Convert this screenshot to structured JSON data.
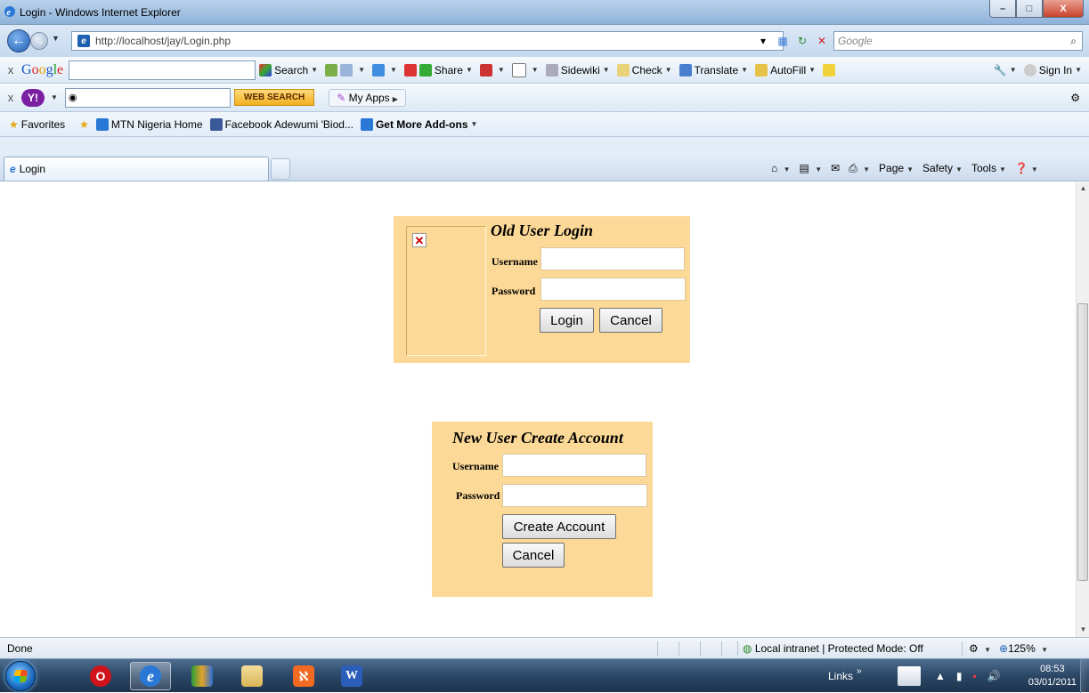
{
  "window": {
    "title": "Login - Windows Internet Explorer",
    "controls": {
      "minimize": "–",
      "maximize": "□",
      "close": "X"
    }
  },
  "address_bar": {
    "url": "http://localhost/jay/Login.php",
    "search_placeholder": "Google"
  },
  "google_toolbar": {
    "close": "x",
    "logo": [
      "G",
      "o",
      "o",
      "g",
      "l",
      "e"
    ],
    "items": [
      {
        "label": "Search",
        "icon": "search-icon"
      },
      {
        "label": "Share",
        "icon": "share-icon"
      },
      {
        "label": "Sidewiki",
        "icon": "sidewiki-icon"
      },
      {
        "label": "Check",
        "icon": "spellcheck-icon"
      },
      {
        "label": "Translate",
        "icon": "translate-icon"
      },
      {
        "label": "AutoFill",
        "icon": "autofill-icon"
      }
    ],
    "sign_in": "Sign In"
  },
  "yahoo_toolbar": {
    "close": "x",
    "logo": "Y!",
    "web_search": "WEB SEARCH",
    "my_apps": "My Apps"
  },
  "favorites_bar": {
    "favorites": "Favorites",
    "items": [
      {
        "label": "MTN Nigeria Home",
        "icon": "ie-page-icon"
      },
      {
        "label": "Facebook Adewumi 'Biod...",
        "icon": "facebook-icon"
      },
      {
        "label": "Get More Add-ons",
        "icon": "ie-page-icon"
      }
    ]
  },
  "tabs": {
    "active": "Login",
    "command_bar": [
      "Page",
      "Safety",
      "Tools"
    ]
  },
  "login_form": {
    "title": "Old User Login",
    "username_label": "Username",
    "password_label": "Password",
    "username_value": "",
    "password_value": "",
    "login_button": "Login",
    "cancel_button": "Cancel"
  },
  "create_form": {
    "title": "New User Create Account",
    "username_label": "Username",
    "password_label": "Password",
    "username_value": "",
    "password_value": "",
    "create_button": "Create Account",
    "cancel_button": "Cancel"
  },
  "status_bar": {
    "status": "Done",
    "zone": "Local intranet | Protected Mode: Off",
    "zoom": "125%"
  },
  "taskbar": {
    "links": "Links",
    "time": "08:53",
    "date": "03/01/2011"
  },
  "colors": {
    "form_panel": "#fcd996",
    "titlebar": "#a7c4e4",
    "taskbar": "#2b4766"
  }
}
